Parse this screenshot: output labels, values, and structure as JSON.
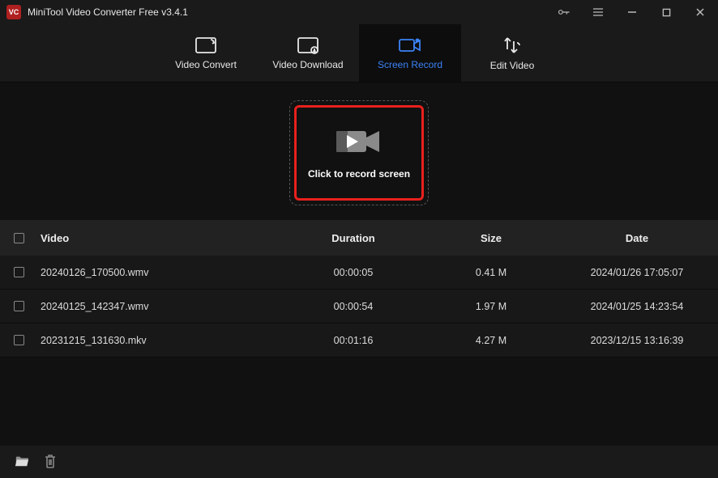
{
  "app": {
    "title": "MiniTool Video Converter Free v3.4.1"
  },
  "tabs": {
    "convert": "Video Convert",
    "download": "Video Download",
    "record": "Screen Record",
    "edit": "Edit Video"
  },
  "record_panel": {
    "caption": "Click to record screen"
  },
  "table": {
    "headers": {
      "video": "Video",
      "duration": "Duration",
      "size": "Size",
      "date": "Date"
    },
    "rows": [
      {
        "video": "20240126_170500.wmv",
        "duration": "00:00:05",
        "size": "0.41 M",
        "date": "2024/01/26 17:05:07"
      },
      {
        "video": "20240125_142347.wmv",
        "duration": "00:00:54",
        "size": "1.97 M",
        "date": "2024/01/25 14:23:54"
      },
      {
        "video": "20231215_131630.mkv",
        "duration": "00:01:16",
        "size": "4.27 M",
        "date": "2023/12/15 13:16:39"
      }
    ]
  }
}
